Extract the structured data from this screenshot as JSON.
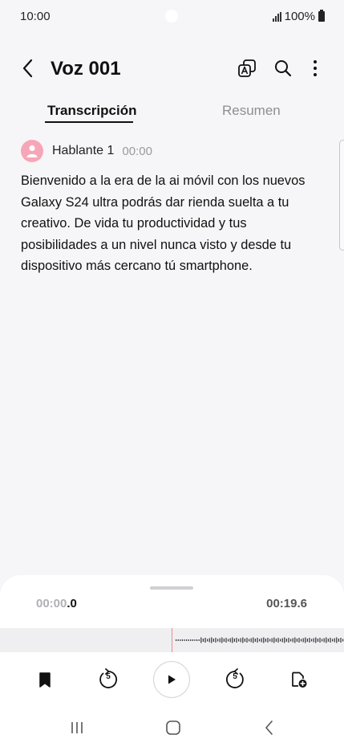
{
  "status_bar": {
    "time": "10:00",
    "battery": "100%"
  },
  "app_bar": {
    "title": "Voz 001"
  },
  "tabs": [
    {
      "label": "Transcripción",
      "active": true
    },
    {
      "label": "Resumen",
      "active": false
    }
  ],
  "transcript": {
    "speaker": "Hablante 1",
    "timestamp": "00:00",
    "text": "Bienvenido a la era de la ai móvil con los nuevos Galaxy S24 ultra podrás dar rienda suelta a tu creativo. De vida tu productividad y tus posibilidades a un nivel nunca visto y desde tu dispositivo más cercano tú smartphone."
  },
  "player": {
    "current_dim": "00:00",
    "current_hl": ".0",
    "total": "00:19.6",
    "skip_back_seconds": "5",
    "skip_forward_seconds": "5"
  },
  "colors": {
    "accent": "#f7a6b7",
    "playhead": "#f08a8a",
    "background": "#f6f6f8"
  }
}
